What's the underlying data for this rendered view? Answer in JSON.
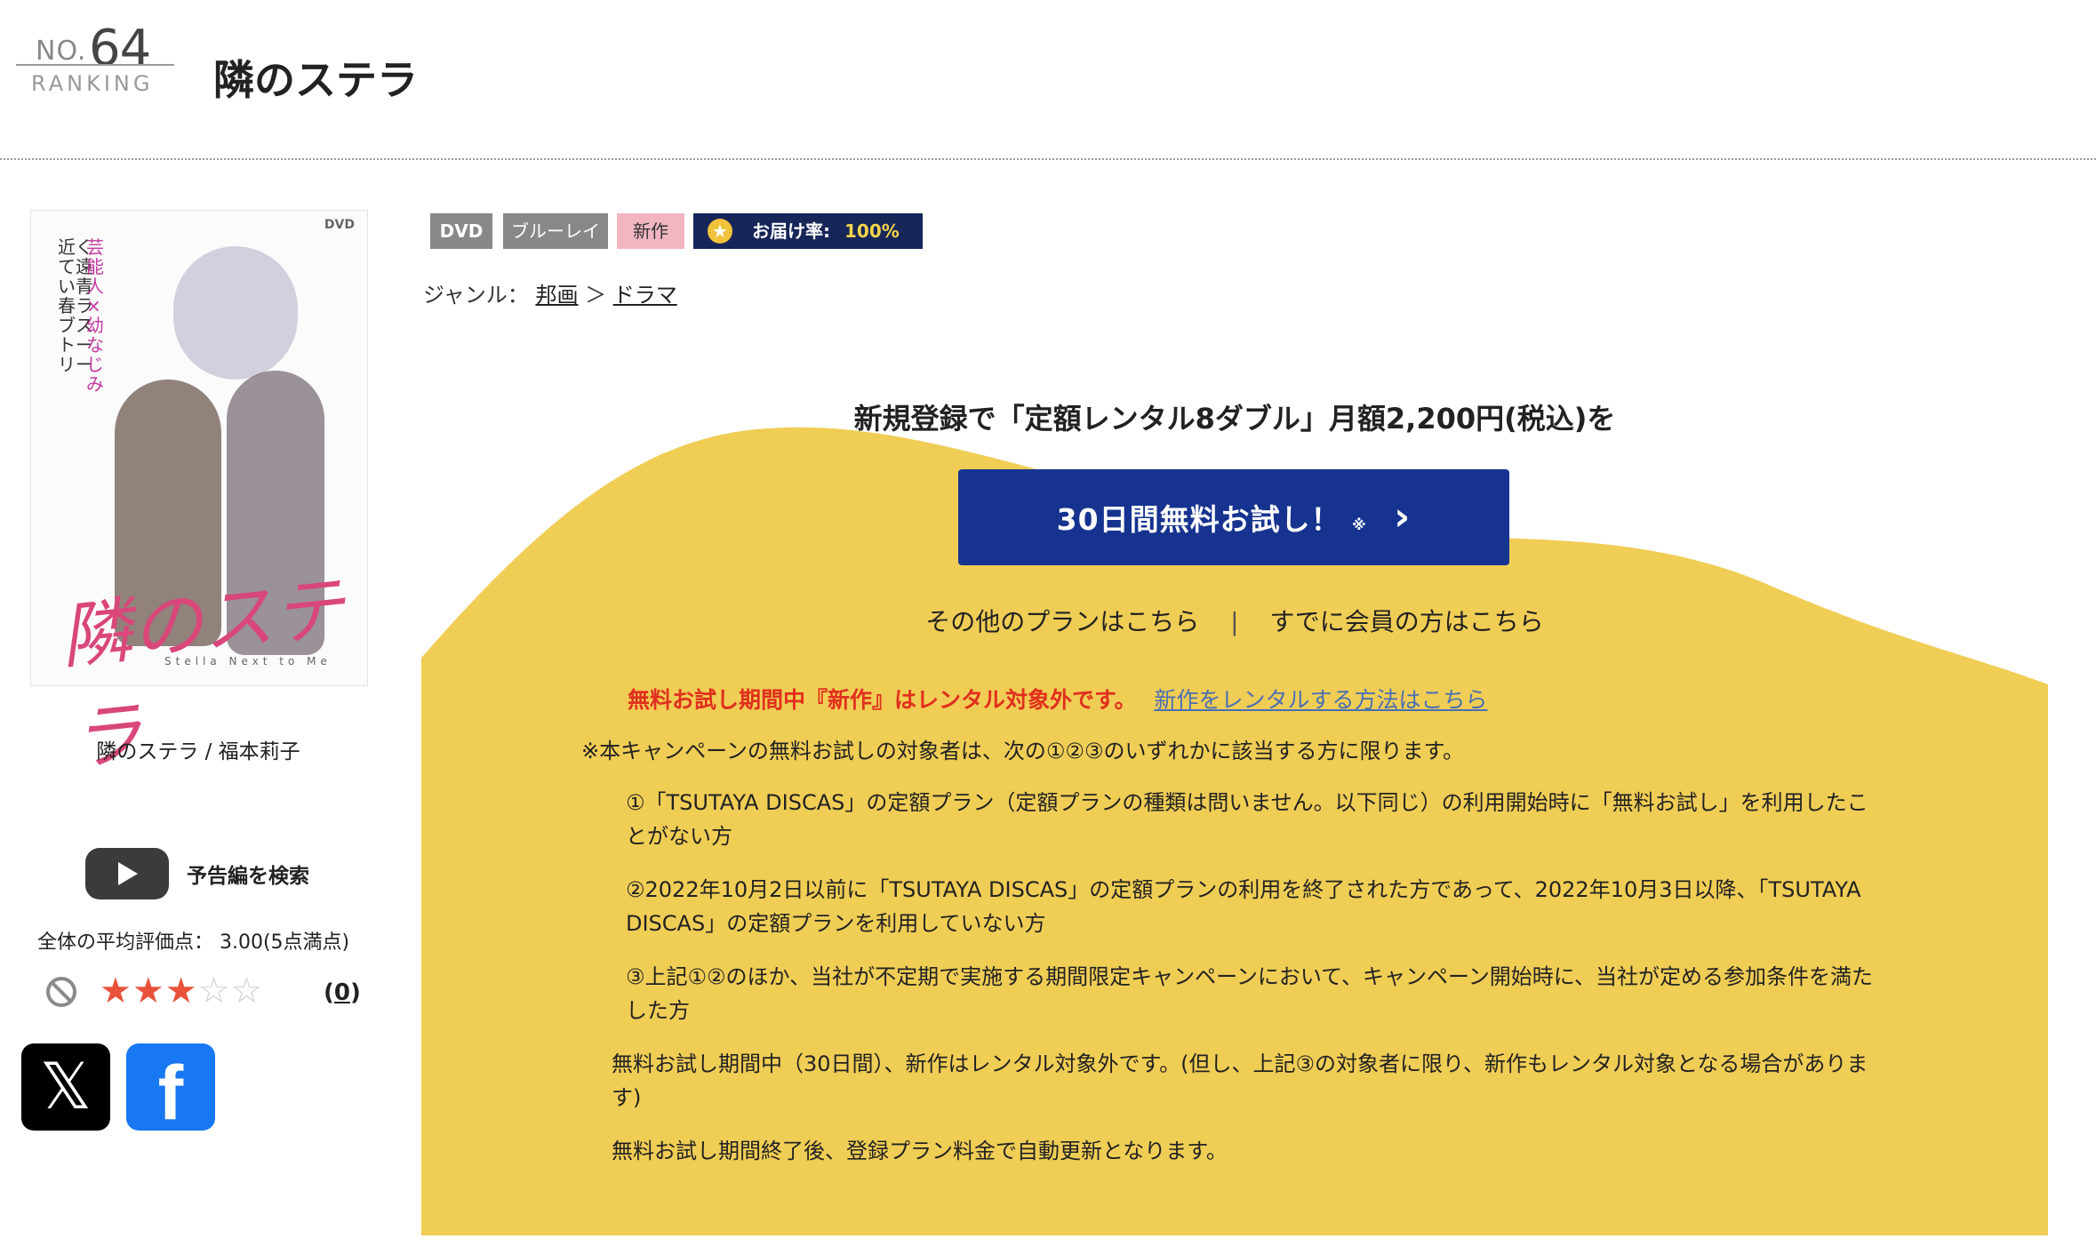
{
  "ranking": {
    "no_prefix": "NO.",
    "number": "64",
    "label": "RANKING"
  },
  "title": "隣のステラ",
  "cover": {
    "title_art": "隣のステラ",
    "format_mark": "DVD",
    "subtitle": "Stella Next to Me",
    "tagline": "近くて遠い青春ラブストーリー",
    "tagline2": "芸能人×幼なじみ"
  },
  "caption": "隣のステラ / 福本莉子",
  "trailer_label": "予告編を検索",
  "rating": {
    "average_text": "全体の平均評価点： 3.00(5点満点)",
    "value": 3,
    "max": 5,
    "count": "0",
    "filled_star": "★",
    "empty_star": "☆"
  },
  "share": {
    "x_glyph": "𝕏",
    "facebook_glyph": "f"
  },
  "tags": {
    "dvd": "DVD",
    "bluray": "ブルーレイ",
    "new": "新作",
    "delivery_label": "お届け率:",
    "delivery_value": "100%",
    "star_glyph": "★"
  },
  "genre": {
    "label": "ジャンル：",
    "crumb1": "邦画",
    "sep": "＞",
    "crumb2": "ドラマ"
  },
  "campaign": {
    "headline": "新規登録で「定額レンタル8ダブル」月額2,200円(税込)を",
    "cta_label": "30日間無料お試し！",
    "cta_mark": "※",
    "cta_chevron": "›",
    "other_plans": "その他のプランはこちら",
    "divider": "|",
    "member_link": "すでに会員の方はこちら",
    "warning": "無料お試し期間中『新作』はレンタル対象外です。",
    "warning_link": "新作をレンタルする方法はこちら",
    "note_intro": "※本キャンペーンの無料お試しの対象者は、次の①②③のいずれかに該当する方に限ります。",
    "note1": "①「TSUTAYA DISCAS」の定額プラン（定額プランの種類は問いません。以下同じ）の利用開始時に「無料お試し」を利用したことがない方",
    "note2": "②2022年10月2日以前に「TSUTAYA DISCAS」の定額プランの利用を終了された方であって、2022年10月3日以降、「TSUTAYA DISCAS」の定額プランを利用していない方",
    "note3": "③上記①②のほか、当社が不定期で実施する期間限定キャンペーンにおいて、キャンペーン開始時に、当社が定める参加条件を満たした方",
    "note4": "無料お試し期間中（30日間）、新作はレンタル対象外です。(但し、上記③の対象者に限り、新作もレンタル対象となる場合があります)",
    "note5": "無料お試し期間終了後、登録プラン料金で自動更新となります。"
  },
  "colors": {
    "campaign_bg": "#f0cd55",
    "cta_bg": "#16338f",
    "delivery_bg": "#172659",
    "warning_red": "#e0301e",
    "link_blue": "#4a6fb3",
    "star_on": "#e8523b",
    "facebook_blue": "#1877f2"
  }
}
